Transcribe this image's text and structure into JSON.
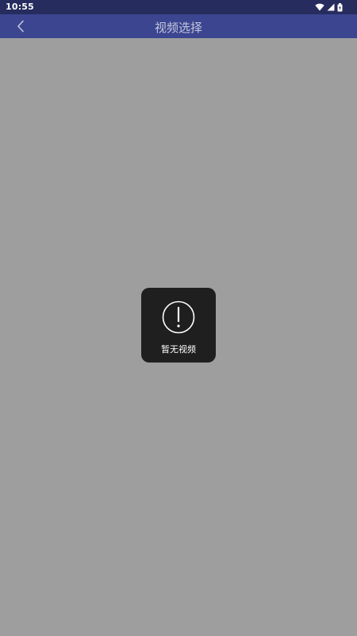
{
  "status_bar": {
    "time": "10:55",
    "icons": [
      "wifi-icon",
      "signal-icon",
      "battery-icon"
    ],
    "color": "#262c5e"
  },
  "app_bar": {
    "title": "视频选择",
    "back_icon": "back-chevron-icon",
    "color": "#3b4590"
  },
  "content": {
    "background": "#9e9e9e"
  },
  "empty_state": {
    "icon": "alert-circle-icon",
    "message": "暂无视频",
    "background": "#1f1f1f"
  }
}
